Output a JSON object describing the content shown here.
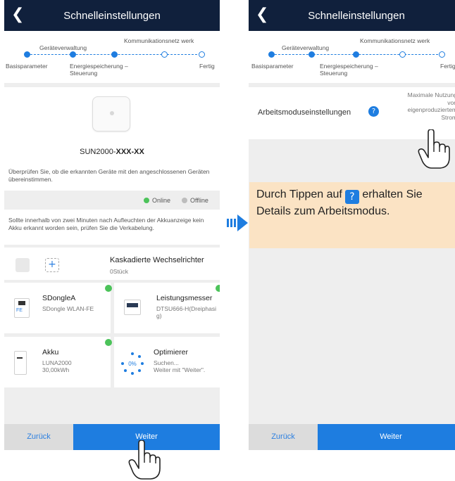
{
  "left_screen": {
    "header": {
      "back_icon": "chevron-left-icon",
      "title": "Schnelleinstellungen"
    },
    "steps": {
      "labels_top": [
        "Geräteverwaltung",
        "Kommunikationsnetz werk"
      ],
      "labels_bottom": [
        "Basisparameter",
        "Energiespeicherung – Steuerung",
        "Fertig"
      ]
    },
    "device": {
      "name": "SUN2000-",
      "name_suffix": "XXX-XX",
      "description": "Überprüfen Sie, ob die erkannten Geräte mit den angeschlossenen Geräten übereinstimmen."
    },
    "legend": {
      "online": "Online",
      "offline": "Offline",
      "online_color": "#4cc35a",
      "offline_color": "#bdbdbd"
    },
    "notice": "Sollte innerhalb von zwei Minuten nach Aufleuchten der Akkuanzeige kein Akku erkannt worden sein, prüfen Sie die Verkabelung.",
    "cascade": {
      "title": "Kaskadierte Wechselrichter",
      "count": "0Stück",
      "add_symbol": "+"
    },
    "cards": [
      {
        "title": "SDongleA",
        "subtitle": "SDongle WLAN-FE",
        "icon_label": "FE"
      },
      {
        "title": "Leistungsmesser",
        "subtitle": "DTSU666-H(Dreiphasig)"
      },
      {
        "title": "Akku",
        "subtitle": "LUNA2000\n30,00kWh"
      },
      {
        "title": "Optimierer",
        "subtitle": "Suchen...\nWeiter mit \"Weiter\".",
        "progress": "0%"
      }
    ],
    "footer": {
      "back": "Zurück",
      "next": "Weiter"
    }
  },
  "right_screen": {
    "header": {
      "back_icon": "chevron-left-icon",
      "title": "Schnelleinstellungen"
    },
    "steps": {
      "labels_top": [
        "Geräteverwaltung",
        "Kommunikationsnetz werk"
      ],
      "labels_bottom": [
        "Basisparameter",
        "Energiespeicherung – Steuerung",
        "Fertig"
      ]
    },
    "mode": {
      "label": "Arbeitsmoduseinstellungen",
      "help_symbol": "?",
      "value": "Maximale Nutzung von eigenproduziertem Strom"
    },
    "footer": {
      "back": "Zurück",
      "next": "Weiter"
    }
  },
  "hint": {
    "text_before": "Durch Tippen auf",
    "icon_symbol": "?",
    "text_after": "erhalten Sie Details zum Arbeitsmodus."
  },
  "colors": {
    "header_bg": "#10203c",
    "accent_blue": "#1e7de0",
    "hint_bg": "#fbe3c4",
    "online_green": "#4cc35a"
  }
}
